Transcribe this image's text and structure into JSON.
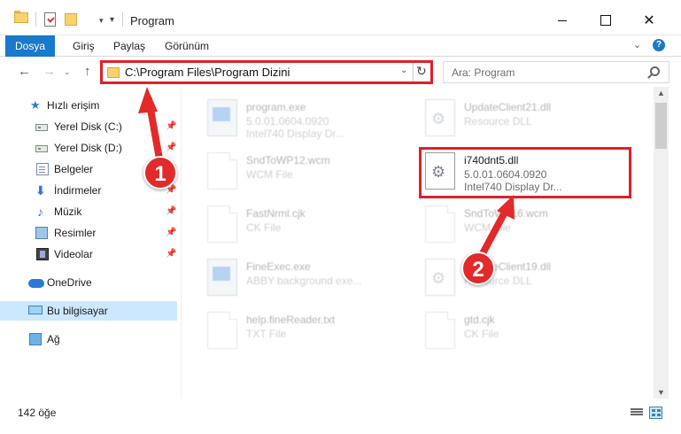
{
  "window": {
    "title": "Program",
    "minimize_icon": "minimize-icon",
    "maximize_icon": "maximize-icon",
    "close_glyph": "✕"
  },
  "ribbon": {
    "tabs": [
      {
        "label": "Dosya",
        "active": true
      },
      {
        "label": "Giriş"
      },
      {
        "label": "Paylaş"
      },
      {
        "label": "Görünüm"
      }
    ],
    "help_glyph": "?",
    "collapse_glyph": "⌄"
  },
  "nav": {
    "back_glyph": "←",
    "forward_glyph": "→",
    "recent_glyph": "⌄",
    "up_glyph": "↑",
    "address": "C:\\Program Files\\Program Dizini",
    "address_dropdown_glyph": "⌄",
    "refresh_glyph": "↻",
    "search_placeholder": "Ara: Program"
  },
  "sidebar": {
    "items": [
      {
        "label": "Hızlı erişim",
        "icon": "star-icon",
        "glyph": "★"
      },
      {
        "label": "Yerel Disk (C:)",
        "icon": "disk-icon",
        "pinned": true
      },
      {
        "label": "Yerel Disk (D:)",
        "icon": "disk-icon",
        "pinned": true
      },
      {
        "label": "Belgeler",
        "icon": "documents-icon",
        "pinned": true
      },
      {
        "label": "İndirmeler",
        "icon": "download-icon",
        "glyph": "⬇",
        "pinned": true
      },
      {
        "label": "Müzik",
        "icon": "music-icon",
        "glyph": "♪",
        "pinned": true
      },
      {
        "label": "Resimler",
        "icon": "pictures-icon",
        "pinned": true
      },
      {
        "label": "Videolar",
        "icon": "videos-icon",
        "pinned": true
      },
      {
        "label": "OneDrive",
        "icon": "onedrive-icon"
      },
      {
        "label": "Bu bilgisayar",
        "icon": "computer-icon",
        "selected": true
      },
      {
        "label": "Ağ",
        "icon": "network-icon"
      }
    ],
    "pin_glyph": "📌"
  },
  "files": [
    {
      "name": "program.exe",
      "line1": "5.0.01.0604.0920",
      "line2": "Intel740 Display Dr...",
      "icon": "exe-icon",
      "faded": true
    },
    {
      "name": "UpdateClient21.dll",
      "line1": "Resource DLL",
      "line2": "",
      "icon": "dll-gear-icon",
      "faded": true
    },
    {
      "name": "SndToWP12.wcm",
      "line1": "WCM File",
      "line2": "",
      "icon": "file-icon",
      "faded": true
    },
    {
      "name": "i740dnt5.dll",
      "line1": "5.0.01.0604.0920",
      "line2": "Intel740 Display Dr...",
      "icon": "dll-gear-icon",
      "faded": false,
      "highlighted": true
    },
    {
      "name": "FastNrml.cjk",
      "line1": "CK File",
      "line2": "",
      "icon": "file-icon",
      "faded": true
    },
    {
      "name": "SndToWP16.wcm",
      "line1": "WCM File",
      "line2": "",
      "icon": "file-icon",
      "faded": true
    },
    {
      "name": "FineExec.exe",
      "line1": "ABBY background exe...",
      "line2": "",
      "icon": "exe-icon",
      "faded": true
    },
    {
      "name": "UpdateClient19.dll",
      "line1": "Resource DLL",
      "line2": "",
      "icon": "dll-gear-icon",
      "faded": true
    },
    {
      "name": "help.fineReader.txt",
      "line1": "TXT File",
      "line2": "",
      "icon": "file-icon",
      "faded": true
    },
    {
      "name": "gtd.cjk",
      "line1": "CK File",
      "line2": "",
      "icon": "file-icon",
      "faded": true
    }
  ],
  "status": {
    "count": "142 öğe"
  },
  "annotations": {
    "badge1": "1",
    "badge2": "2",
    "color": "#e22a2a"
  },
  "colors": {
    "accent": "#1979ca",
    "highlight": "#e0202a",
    "selection": "#cce8ff"
  }
}
